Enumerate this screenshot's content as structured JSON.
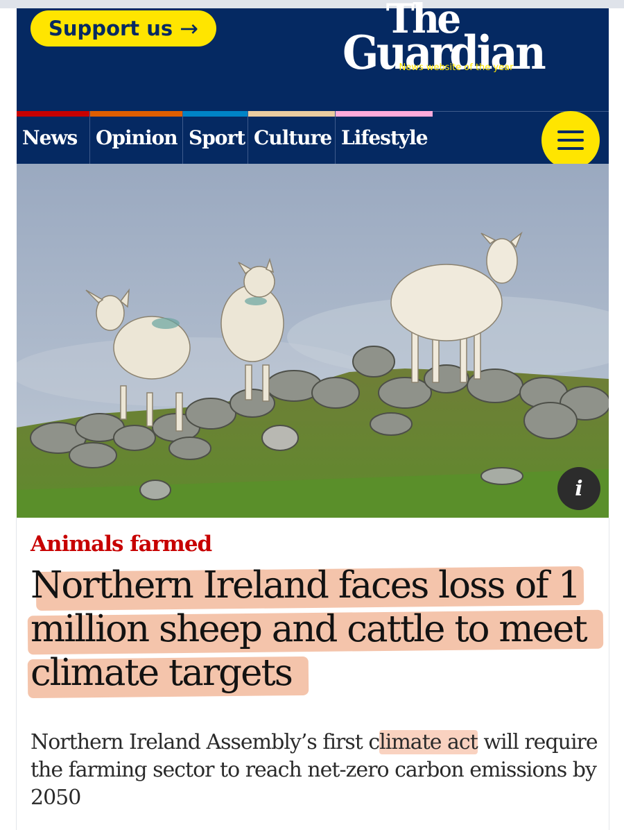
{
  "header": {
    "support_label": "Support us",
    "support_arrow": "→",
    "logo_the": "The",
    "logo_guardian": "Guardian",
    "tagline": "News website of the year"
  },
  "nav": {
    "items": [
      {
        "label": "News",
        "color": "#c70000"
      },
      {
        "label": "Opinion",
        "color": "#e05e00"
      },
      {
        "label": "Sport",
        "color": "#0084c6"
      },
      {
        "label": "Culture",
        "color": "#eacca0"
      },
      {
        "label": "Lifestyle",
        "color": "#ffabdb"
      }
    ],
    "menu_icon": "hamburger-icon"
  },
  "photo": {
    "info_label": "i"
  },
  "article": {
    "kicker": "Animals farmed",
    "headline_lines": [
      "Northern Ireland faces loss of 1",
      "million sheep and cattle to meet",
      "climate targets"
    ],
    "standfirst": {
      "before": "Northern Ireland Assembly’s first c",
      "highlight": "limate act",
      "after": " will require the farming sector to reach net-zero carbon emissions by 2050"
    }
  },
  "colors": {
    "brand_navy": "#052962",
    "brand_yellow": "#ffe500",
    "kicker_red": "#c70000",
    "highlighter": "#eea078"
  }
}
